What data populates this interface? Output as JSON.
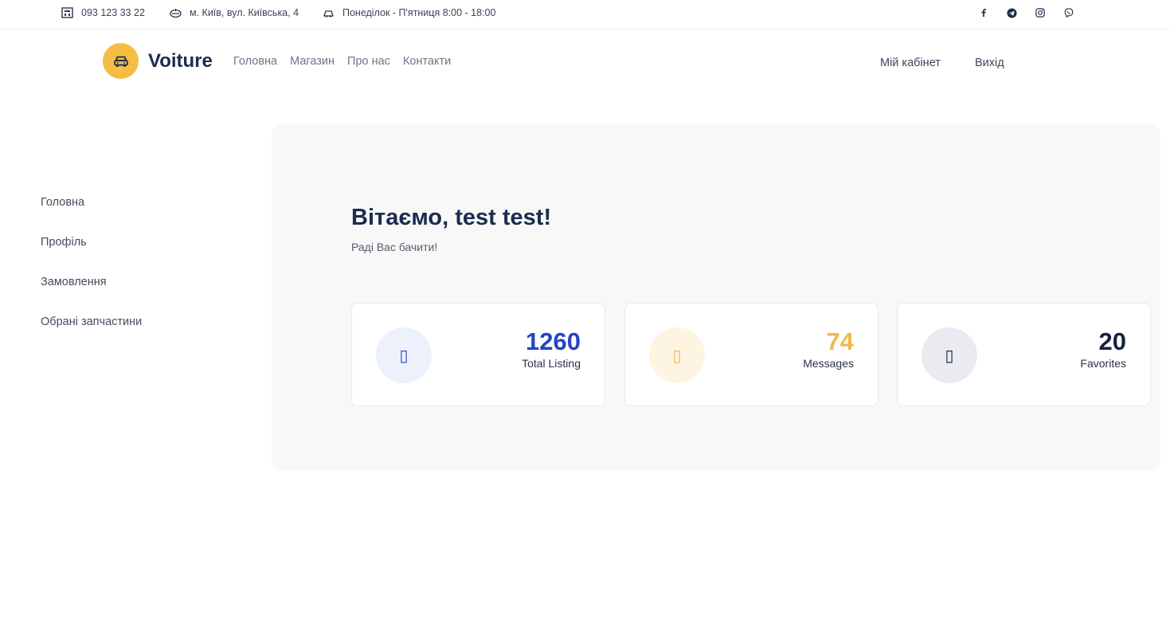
{
  "topbar": {
    "phone": "093 123 33 22",
    "address": "м. Київ, вул. Київська, 4",
    "hours": "Понеділок - П'ятниця 8:00 - 18:00",
    "social": [
      "facebook-icon",
      "telegram-icon",
      "instagram-icon",
      "viber-icon"
    ]
  },
  "header": {
    "logo_text": "Voiture",
    "nav": [
      "Головна",
      "Магазин",
      "Про нас",
      "Контакти"
    ],
    "account": "Мій кабінет",
    "logout": "Вихід"
  },
  "sidebar": {
    "items": [
      "Головна",
      "Профіль",
      "Замовлення",
      "Обрані запчастини"
    ]
  },
  "main": {
    "welcome": "Вітаємо, test test!",
    "subtitle": "Раді Вас бачити!",
    "cards": [
      {
        "value": "1260",
        "label": "Total Listing",
        "color": "#2443c6",
        "bg": "#edf1fb",
        "icon_glyph": "▯"
      },
      {
        "value": "74",
        "label": "Messages",
        "color": "#f0b84b",
        "bg": "#fdf4e2",
        "icon_glyph": "▯"
      },
      {
        "value": "20",
        "label": "Favorites",
        "color": "#16213f",
        "bg": "#e9ebf0",
        "icon_glyph": "▯"
      }
    ]
  },
  "colors": {
    "accent": "#f5bd43",
    "brand": "#1c2b4f"
  }
}
